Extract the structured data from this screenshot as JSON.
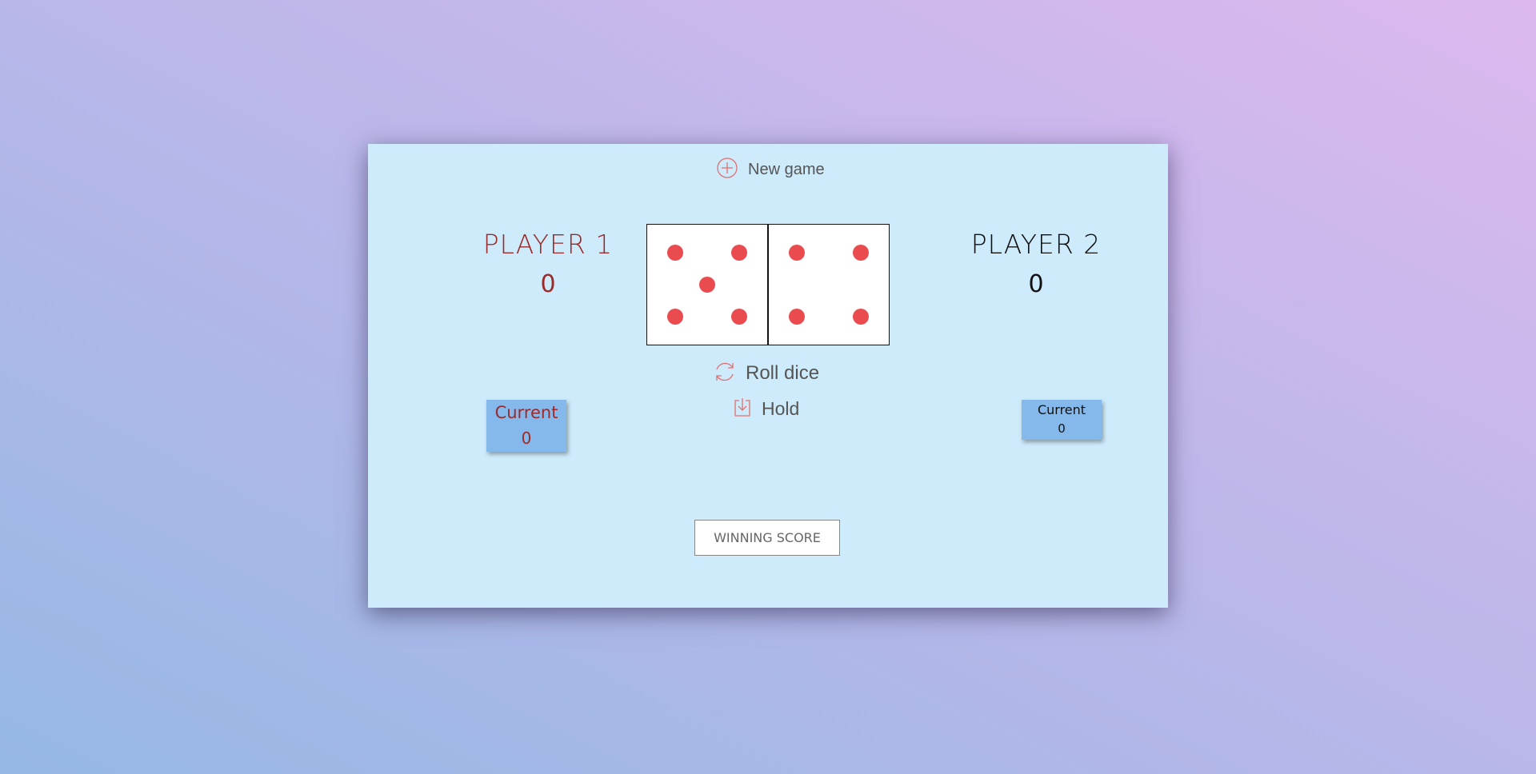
{
  "controls": {
    "new_game_label": "New game",
    "roll_label": "Roll dice",
    "hold_label": "Hold",
    "winning_score_placeholder": "WINNING SCORE",
    "winning_score_value": ""
  },
  "players": [
    {
      "name": "PLAYER 1",
      "score": "0",
      "current_label": "Current",
      "current_value": "0",
      "active": true
    },
    {
      "name": "PLAYER 2",
      "score": "0",
      "current_label": "Current",
      "current_value": "0",
      "active": false
    }
  ],
  "dice": [
    5,
    4
  ],
  "colors": {
    "board": "#ceebfb",
    "active_player": "#9b2a2a",
    "pip": "#e94b4f",
    "current_box": "#85b9ec",
    "icon": "#e07070"
  },
  "icons": {
    "new_game": "plus-circle-icon",
    "roll": "refresh-icon",
    "hold": "download-icon"
  }
}
